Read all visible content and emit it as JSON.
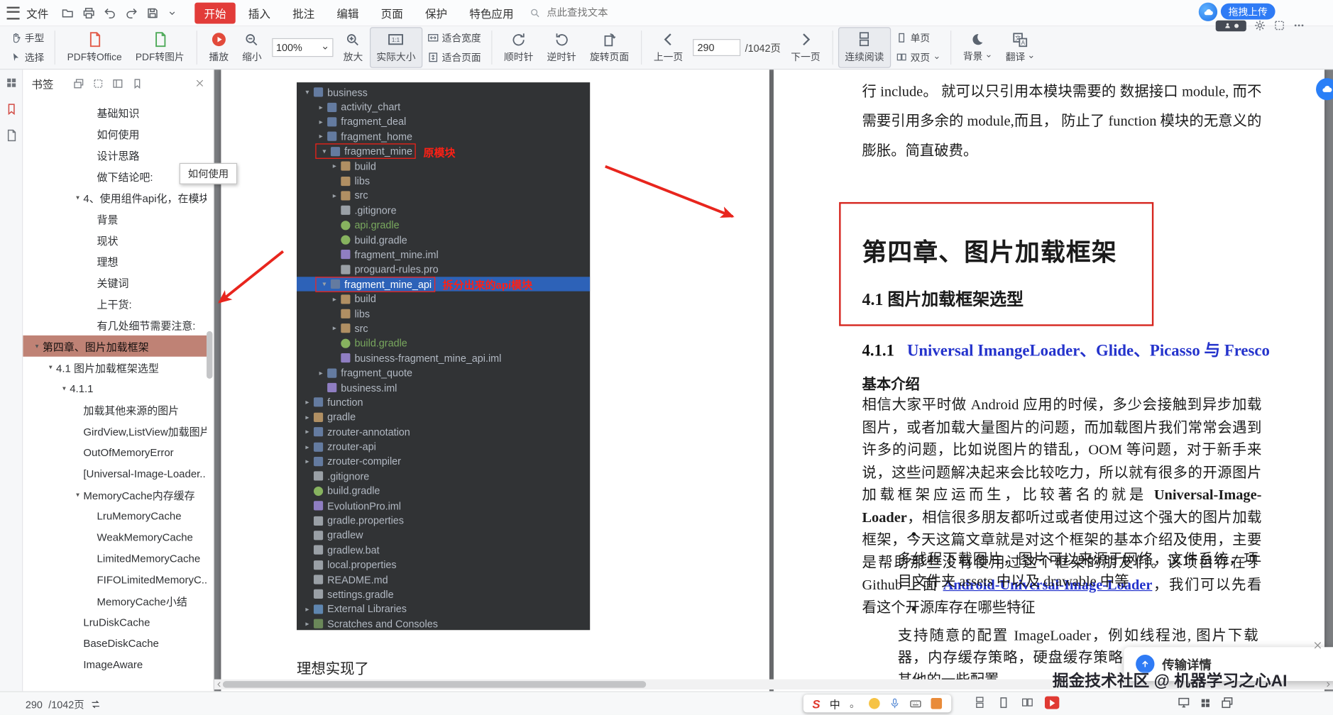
{
  "colors": {
    "accent_red": "#e23c39",
    "selection_blue": "#2d62b8",
    "link_blue": "#2433cc",
    "bookmark_selected": "#bf8275",
    "annotation_red": "#e8251d",
    "upload_blue": "#2f7bf5"
  },
  "icons": {
    "menu": "hamburger-bars",
    "open": "folder",
    "print": "printer",
    "undo": "arrow-undo",
    "redo": "arrow-redo",
    "save": "floppy-disk",
    "search": "magnifier",
    "hand": "hand",
    "select": "cursor-arrow",
    "play": "play-circle",
    "zoom_out": "magnifier-minus",
    "zoom_in": "magnifier-plus",
    "actual_size": "one-to-one",
    "rotate_cw": "circular-arrow-cw",
    "rotate_ccw": "circular-arrow-ccw",
    "prev": "hollow-arrow-left",
    "next": "hollow-arrow-right",
    "background": "moon",
    "translate": "translate-char",
    "upload": "cloud",
    "settings": "gear",
    "close": "x-cross"
  },
  "menubar": {
    "file": "文件",
    "tabs": [
      {
        "label": "开始",
        "active": true
      },
      {
        "label": "插入"
      },
      {
        "label": "批注"
      },
      {
        "label": "编辑"
      },
      {
        "label": "页面"
      },
      {
        "label": "保护"
      },
      {
        "label": "特色应用"
      }
    ],
    "search_placeholder": "点此查找文本",
    "upload_button": "拖拽上传"
  },
  "ribbon": {
    "hand": "手型",
    "select": "选择",
    "pdf_to_office": "PDF转Office",
    "pdf_to_image": "PDF转图片",
    "play": "播放",
    "zoom_out": "缩小",
    "zoom_value": "100%",
    "zoom_in": "放大",
    "actual_size": "实际大小",
    "fit_width": "适合宽度",
    "fit_page": "适合页面",
    "rotate_cw": "顺时针",
    "rotate_ccw": "逆时针",
    "rotate_page": "旋转页面",
    "prev_page": "上一页",
    "page_current": "290",
    "page_total": "/1042页",
    "next_page": "下一页",
    "continuous": "连续阅读",
    "single_page": "单页",
    "double_page": "双页",
    "background": "背景",
    "translate": "翻译"
  },
  "sidebar": {
    "title": "书签",
    "tooltip": "如何使用",
    "items": [
      {
        "label": "基础知识",
        "indent": 4
      },
      {
        "label": "如何使用",
        "indent": 4
      },
      {
        "label": "设计思路",
        "indent": 4
      },
      {
        "label": "做下结论吧:",
        "indent": 4
      },
      {
        "label": "4、使用组件api化，在模块...",
        "indent": 3,
        "arrow": true
      },
      {
        "label": "背景",
        "indent": 4
      },
      {
        "label": "现状",
        "indent": 4
      },
      {
        "label": "理想",
        "indent": 4
      },
      {
        "label": "关键词",
        "indent": 4
      },
      {
        "label": "上干货:",
        "indent": 4
      },
      {
        "label": "有几处细节需要注意:",
        "indent": 4
      },
      {
        "label": "第四章、图片加载框架",
        "indent": 0,
        "arrow": true,
        "selected": true
      },
      {
        "label": "4.1 图片加载框架选型",
        "indent": 1,
        "arrow": true
      },
      {
        "label": "4.1.1",
        "indent": 2,
        "arrow": true
      },
      {
        "label": "加载其他来源的图片",
        "indent": 3
      },
      {
        "label": "GirdView,ListView加载图片",
        "indent": 3
      },
      {
        "label": "OutOfMemoryError",
        "indent": 3
      },
      {
        "label": "[Universal-Image-Loader...",
        "indent": 3
      },
      {
        "label": "MemoryCache内存缓存",
        "indent": 3,
        "arrow": true
      },
      {
        "label": "LruMemoryCache",
        "indent": 4
      },
      {
        "label": "WeakMemoryCache",
        "indent": 4
      },
      {
        "label": "LimitedMemoryCache",
        "indent": 4
      },
      {
        "label": "FIFOLimitedMemoryC...",
        "indent": 4
      },
      {
        "label": "MemoryCache小结",
        "indent": 4
      },
      {
        "label": "LruDiskCache",
        "indent": 3
      },
      {
        "label": "BaseDiskCache",
        "indent": 3
      },
      {
        "label": "ImageAware",
        "indent": 3
      }
    ]
  },
  "project_tree": {
    "rows": [
      {
        "i": 0,
        "a": "v",
        "ic": "mod",
        "t": "business"
      },
      {
        "i": 1,
        "a": ">",
        "ic": "mod",
        "t": "activity_chart"
      },
      {
        "i": 1,
        "a": ">",
        "ic": "mod",
        "t": "fragment_deal"
      },
      {
        "i": 1,
        "a": ">",
        "ic": "mod",
        "t": "fragment_home"
      },
      {
        "i": 1,
        "a": "v",
        "ic": "mod",
        "t": "fragment_mine",
        "box": true,
        "x": "原模块"
      },
      {
        "i": 2,
        "a": ">",
        "ic": "dir",
        "t": "build"
      },
      {
        "i": 2,
        "a": "",
        "ic": "dir",
        "t": "libs"
      },
      {
        "i": 2,
        "a": ">",
        "ic": "dir",
        "t": "src"
      },
      {
        "i": 2,
        "a": "",
        "ic": "file",
        "t": ".gitignore"
      },
      {
        "i": 2,
        "a": "",
        "ic": "gradle",
        "t": "api.gradle",
        "c": "green"
      },
      {
        "i": 2,
        "a": "",
        "ic": "gradle",
        "t": "build.gradle"
      },
      {
        "i": 2,
        "a": "",
        "ic": "iml",
        "t": "fragment_mine.iml"
      },
      {
        "i": 2,
        "a": "",
        "ic": "file",
        "t": "proguard-rules.pro"
      },
      {
        "i": 1,
        "a": "v",
        "ic": "mod",
        "t": "fragment_mine_api",
        "sel": true,
        "box": true,
        "x": "拆分出来的api模块"
      },
      {
        "i": 2,
        "a": ">",
        "ic": "dir",
        "t": "build"
      },
      {
        "i": 2,
        "a": "",
        "ic": "dir",
        "t": "libs"
      },
      {
        "i": 2,
        "a": ">",
        "ic": "dir",
        "t": "src"
      },
      {
        "i": 2,
        "a": "",
        "ic": "gradle",
        "t": "build.gradle",
        "c": "green"
      },
      {
        "i": 2,
        "a": "",
        "ic": "iml",
        "t": "business-fragment_mine_api.iml"
      },
      {
        "i": 1,
        "a": ">",
        "ic": "mod",
        "t": "fragment_quote"
      },
      {
        "i": 1,
        "a": "",
        "ic": "iml",
        "t": "business.iml"
      },
      {
        "i": 0,
        "a": ">",
        "ic": "mod",
        "t": "function"
      },
      {
        "i": 0,
        "a": ">",
        "ic": "dir",
        "t": "gradle"
      },
      {
        "i": 0,
        "a": ">",
        "ic": "mod",
        "t": "zrouter-annotation"
      },
      {
        "i": 0,
        "a": ">",
        "ic": "mod",
        "t": "zrouter-api"
      },
      {
        "i": 0,
        "a": ">",
        "ic": "mod",
        "t": "zrouter-compiler"
      },
      {
        "i": 0,
        "a": "",
        "ic": "file",
        "t": ".gitignore"
      },
      {
        "i": 0,
        "a": "",
        "ic": "gradle",
        "t": "build.gradle"
      },
      {
        "i": 0,
        "a": "",
        "ic": "iml",
        "t": "EvolutionPro.iml"
      },
      {
        "i": 0,
        "a": "",
        "ic": "file",
        "t": "gradle.properties"
      },
      {
        "i": 0,
        "a": "",
        "ic": "file",
        "t": "gradlew"
      },
      {
        "i": 0,
        "a": "",
        "ic": "file",
        "t": "gradlew.bat"
      },
      {
        "i": 0,
        "a": "",
        "ic": "file",
        "t": "local.properties"
      },
      {
        "i": 0,
        "a": "",
        "ic": "file",
        "t": "README.md"
      },
      {
        "i": 0,
        "a": "",
        "ic": "file",
        "t": "settings.gradle"
      },
      {
        "i": 0,
        "a": ">",
        "ic": "lib",
        "t": "External Libraries"
      },
      {
        "i": 0,
        "a": ">",
        "ic": "con",
        "t": "Scratches and Consoles"
      }
    ]
  },
  "document": {
    "left_caption": "理想实现了",
    "right": {
      "para_top": "行 include。 就可以只引用本模块需要的 数据接口 module, 而不需要引用多余的 module,而且， 防止了 function 模块的无意义的膨胀。简直破费。",
      "chapter": "第四章、图片加载框架",
      "section": "4.1 图片加载框架选型",
      "sub_num": "4.1.1",
      "sub_title": "Universal ImangeLoader、Glide、Picasso 与 Fresco",
      "intro": "基本介绍",
      "body_a": "相信大家平时做 Android 应用的时候，多少会接触到异步加载图片，或者加载大量图片的问题，而加载图片我们常常会遇到许多的问题，比如说图片的错乱，OOM 等问题，对于新手来说，这些问题解决起来会比较吃力，所以就有很多的开源图片加载框架应运而生，比较著名的就是 ",
      "body_bold": "Universal-Image-Loader",
      "body_b": "，相信很多朋友都听过或者使用过这个强大的图片加载框架，今天这篇文章就是对这个框架的基本介绍及使用，主要是帮助那些没有使用过这个框架的朋友们。该项目存在于 Github 上面 ",
      "body_link": "Android-Universal-Image-Loader",
      "body_c": "，我们可以先看看这个开源库存在哪些特征",
      "bullet_glyph": "•",
      "bullet1": "多线程下载图片，图片可以来源于网络，文件系统，项目文件夹 assets 中以及 drawable 中等",
      "bullet2": "支持随意的配置 ImageLoader，例如线程池, 图片下载器，内存缓存策略，硬盘缓存策略，图片显示选项以及其他的一些配置"
    }
  },
  "statusbar": {
    "page": "290",
    "total": "/1042页",
    "ime": {
      "logo": "S",
      "mode": "中",
      "punct": "。"
    }
  },
  "popup": {
    "label": "传输详情"
  },
  "watermark": "掘金技术社区 @ 机器学习之心AI"
}
